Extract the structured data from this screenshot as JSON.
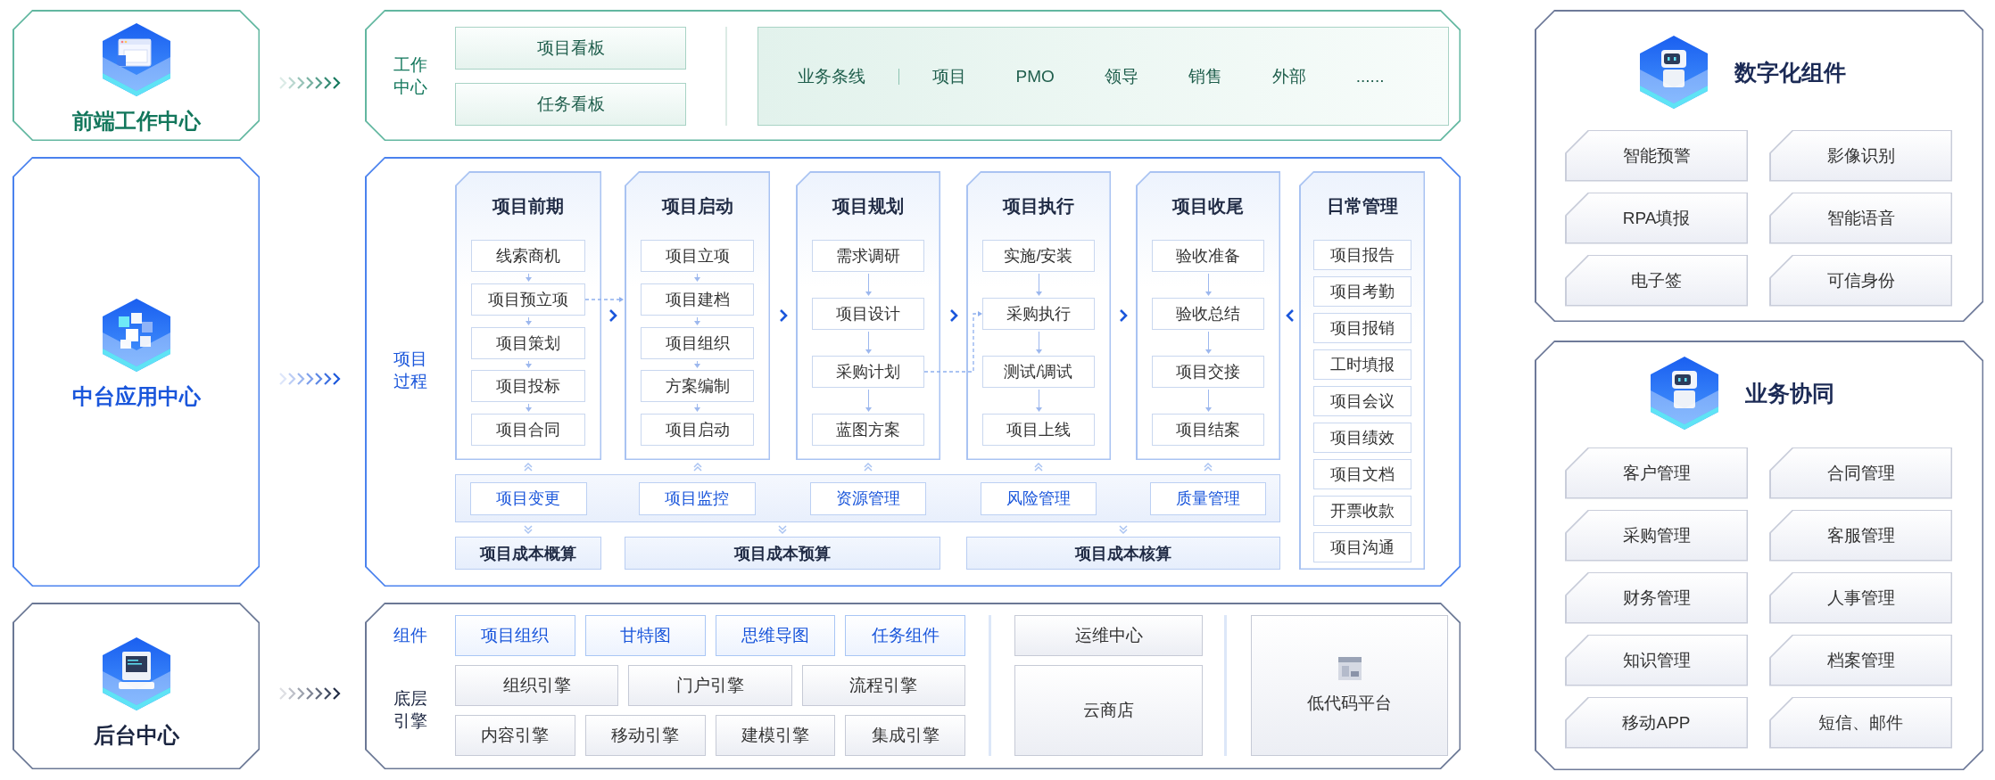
{
  "front_end": {
    "title": "前端工作中心",
    "workspace_label": "工作中心",
    "boards": [
      "项目看板",
      "任务看板"
    ],
    "business_lines": [
      "业务条线",
      "项目",
      "PMO",
      "领导",
      "销售",
      "外部",
      "......"
    ]
  },
  "middle": {
    "title": "中台应用中心",
    "process_label": "项目过程",
    "phases": [
      {
        "title": "项目前期",
        "steps": [
          "线索商机",
          "项目预立项",
          "项目策划",
          "项目投标",
          "项目合同"
        ]
      },
      {
        "title": "项目启动",
        "steps": [
          "项目立项",
          "项目建档",
          "项目组织",
          "方案编制",
          "项目启动"
        ]
      },
      {
        "title": "项目规划",
        "steps": [
          "需求调研",
          "项目设计",
          "采购计划",
          "蓝图方案"
        ]
      },
      {
        "title": "项目执行",
        "steps": [
          "实施/安装",
          "采购执行",
          "测试/调试",
          "项目上线"
        ]
      },
      {
        "title": "项目收尾",
        "steps": [
          "验收准备",
          "验收总结",
          "项目交接",
          "项目结案"
        ]
      }
    ],
    "daily": {
      "title": "日常管理",
      "items": [
        "项目报告",
        "项目考勤",
        "项目报销",
        "工时填报",
        "项目会议",
        "项目绩效",
        "项目文档",
        "开票收款",
        "项目沟通"
      ]
    },
    "controls": [
      "项目变更",
      "项目监控",
      "资源管理",
      "风险管理",
      "质量管理"
    ],
    "costs": [
      "项目成本概算",
      "项目成本预算",
      "项目成本核算"
    ]
  },
  "back_end": {
    "title": "后台中心",
    "components_label": "组件",
    "components": [
      "项目组织",
      "甘特图",
      "思维导图",
      "任务组件"
    ],
    "engine_label": "底层引擎",
    "engine_rows": [
      [
        "组织引擎",
        "门户引擎",
        "流程引擎"
      ],
      [
        "内容引擎",
        "移动引擎",
        "建模引擎",
        "集成引擎"
      ]
    ],
    "services": [
      "运维中心",
      "云商店"
    ],
    "low_code": "低代码平台"
  },
  "digital_components": {
    "title": "数字化组件",
    "items": [
      "智能预警",
      "影像识别",
      "RPA填报",
      "智能语音",
      "电子签",
      "可信身份"
    ]
  },
  "business_collaboration": {
    "title": "业务协同",
    "items": [
      "客户管理",
      "合同管理",
      "采购管理",
      "客服管理",
      "财务管理",
      "人事管理",
      "知识管理",
      "档案管理",
      "移动APP",
      "短信、邮件"
    ]
  }
}
